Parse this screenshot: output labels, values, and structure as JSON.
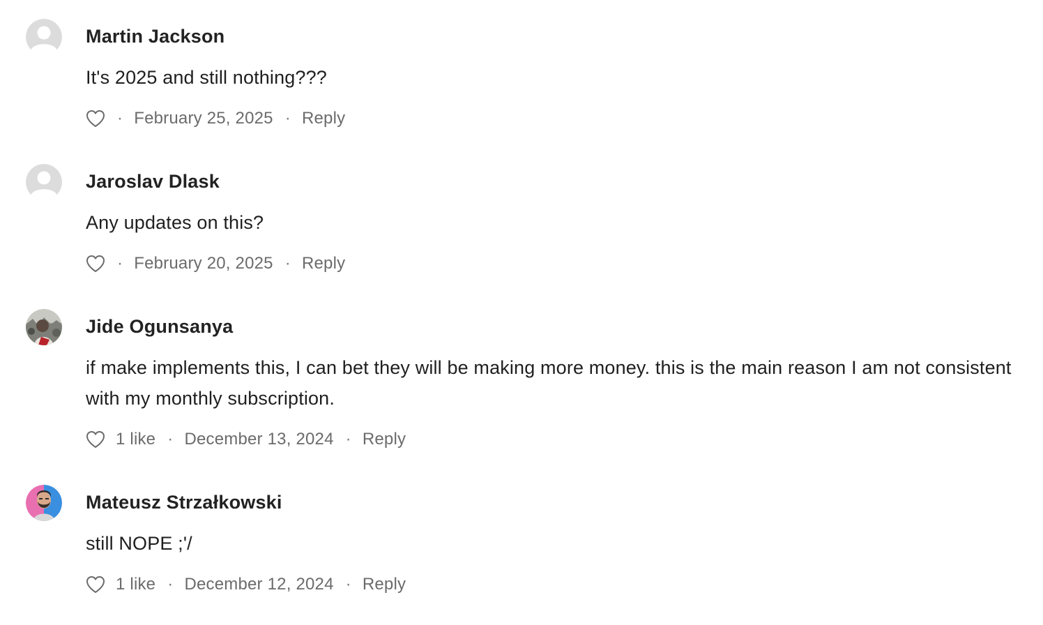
{
  "comments": [
    {
      "author": "Martin Jackson",
      "body": "It's 2025 and still nothing???",
      "likes_label": "",
      "date": "February 25, 2025",
      "reply_label": "Reply",
      "avatar": "default-avatar"
    },
    {
      "author": "Jaroslav Dlask",
      "body": "Any updates on this?",
      "likes_label": "",
      "date": "February 20, 2025",
      "reply_label": "Reply",
      "avatar": "default-avatar"
    },
    {
      "author": "Jide Ogunsanya",
      "body": "if make implements this, I can bet they will be making more money. this is the main reason I am not consistent with my monthly subscription.",
      "likes_label": "1 like",
      "date": "December 13, 2024",
      "reply_label": "Reply",
      "avatar": "photo-avatar"
    },
    {
      "author": "Mateusz Strzałkowski",
      "body": "still NOPE ;'/",
      "likes_label": "1 like",
      "date": "December 12, 2024",
      "reply_label": "Reply",
      "avatar": "photo-avatar"
    }
  ],
  "separator": "·",
  "icons": {
    "like": "heart-outline-icon",
    "default_avatar": "person-silhouette-icon"
  },
  "colors": {
    "author_text": "#222222",
    "body_text": "#1f1f1f",
    "meta_text": "#6b6b6b",
    "default_avatar_bg": "#d9d9d9",
    "avatar_photo_left": "#e86fb0",
    "avatar_photo_right": "#3a8fe0"
  }
}
